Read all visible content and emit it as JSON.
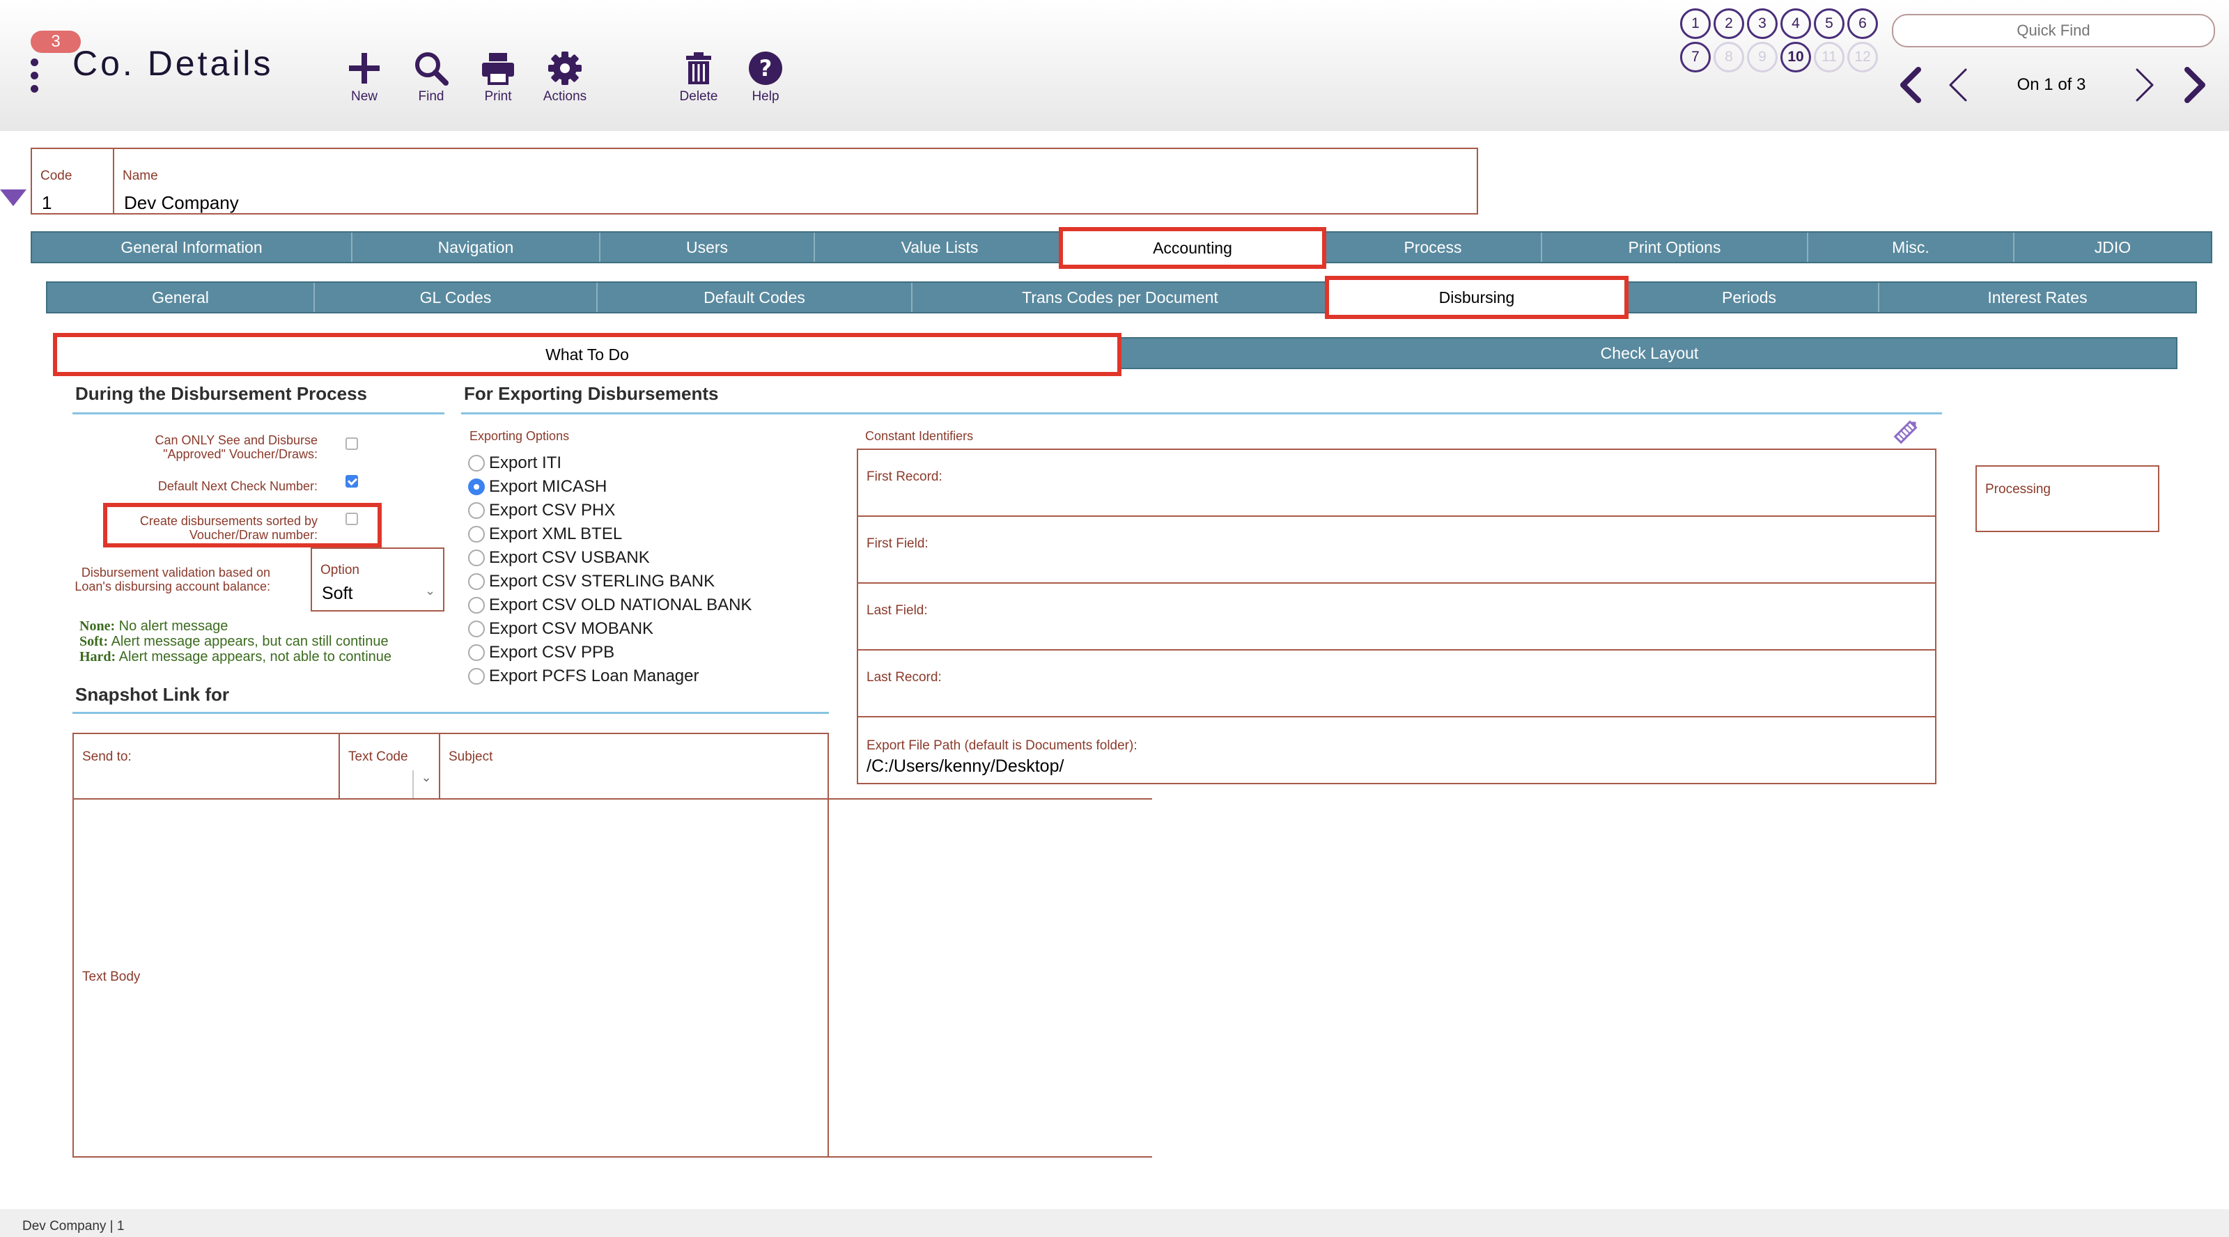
{
  "header": {
    "badge_count": "3",
    "title": "Co. Details",
    "toolbar": [
      {
        "label": "New",
        "icon": "plus-icon"
      },
      {
        "label": "Find",
        "icon": "search-icon"
      },
      {
        "label": "Print",
        "icon": "printer-icon"
      },
      {
        "label": "Actions",
        "icon": "gear-icon"
      },
      {
        "label": "Delete",
        "icon": "trash-icon"
      },
      {
        "label": "Help",
        "icon": "help-icon"
      }
    ],
    "record_slots": [
      "1",
      "2",
      "3",
      "4",
      "5",
      "6",
      "7",
      "8",
      "9",
      "10",
      "11",
      "12"
    ],
    "quick_find_placeholder": "Quick Find",
    "record_count": "On 1 of 3"
  },
  "record": {
    "code_label": "Code",
    "code_value": "1",
    "name_label": "Name",
    "name_value": "Dev Company"
  },
  "main_tabs": [
    "General Information",
    "Navigation",
    "Users",
    "Value Lists",
    "Accounting",
    "Process",
    "Print Options",
    "Misc.",
    "JDIO"
  ],
  "sub_tabs": [
    "General",
    "GL Codes",
    "Default Codes",
    "Trans Codes per Document",
    "Disbursing",
    "Periods",
    "Interest Rates"
  ],
  "third_tabs": [
    "What To Do",
    "Check Layout"
  ],
  "disbursement": {
    "heading": "During the Disbursement Process",
    "can_only_label": "Can ONLY See and Disburse \"Approved\" Voucher/Draws:",
    "default_next_label": "Default Next Check Number:",
    "create_sorted_label": "Create disbursements sorted by Voucher/Draw number:",
    "validation_label": "Disbursement validation based on Loan's disbursing account balance:",
    "option_label": "Option",
    "option_value": "Soft",
    "legend_none_key": "None:",
    "legend_none": " No alert message",
    "legend_soft_key": "Soft:",
    "legend_soft": " Alert message appears, but can still continue",
    "legend_hard_key": "Hard:",
    "legend_hard": " Alert message appears, not able to continue"
  },
  "exporting": {
    "heading": "For Exporting Disbursements",
    "options_label": "Exporting Options",
    "options": [
      "Export ITI",
      "Export MICASH",
      "Export CSV PHX",
      "Export XML BTEL",
      "Export CSV USBANK",
      "Export CSV STERLING BANK",
      "Export CSV OLD NATIONAL BANK",
      "Export CSV MOBANK",
      "Export CSV PPB",
      "Export PCFS Loan Manager"
    ],
    "selected": "Export MICASH",
    "constant_identifiers_label": "Constant Identifiers",
    "first_record_label": "First Record:",
    "first_field_label": "First Field:",
    "last_field_label": "Last Field:",
    "last_record_label": "Last Record:",
    "export_path_label": "Export File Path (default is Documents folder):",
    "export_path_value": "/C:/Users/kenny/Desktop/",
    "processing_label": "Processing"
  },
  "snapshot": {
    "heading": "Snapshot Link for",
    "send_to_label": "Send to:",
    "text_code_label": "Text Code",
    "subject_label": "Subject",
    "text_body_label": "Text Body"
  },
  "status": {
    "text": "Dev Company | 1"
  }
}
